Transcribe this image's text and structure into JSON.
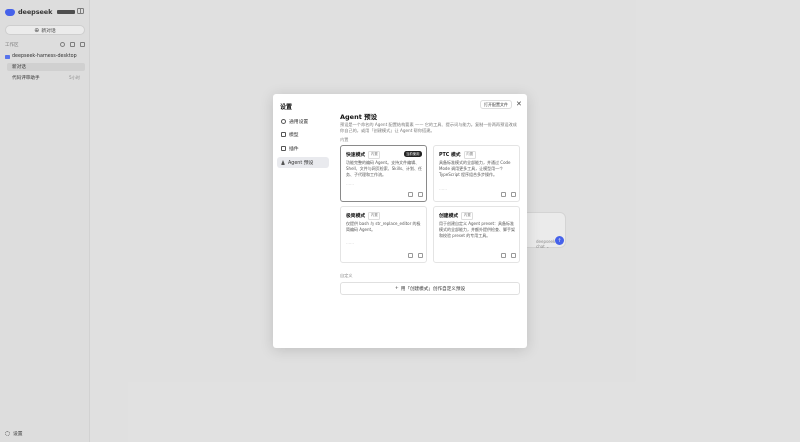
{
  "sidebar": {
    "brand": "deepseek",
    "new_chat": "新对话",
    "workspace_label": "工作区",
    "project": "deepseek-harness-desktop",
    "sessions": [
      {
        "title": "新对话",
        "time": ""
      },
      {
        "title": "代码评审助手",
        "time": "5小时"
      }
    ],
    "settings": "设置"
  },
  "main": {
    "model_label": "deepseek-chat ⌄"
  },
  "modal": {
    "title": "设置",
    "nav": [
      {
        "label": "通用设置",
        "icon": "settings-icon"
      },
      {
        "label": "模型",
        "icon": "model-icon"
      },
      {
        "label": "插件",
        "icon": "plugin-icon"
      },
      {
        "label": "Agent 预设",
        "icon": "agent-icon"
      }
    ],
    "open_config": "打开配置文件",
    "close": "✕",
    "section_title": "Agent 预设",
    "description": "预设是一个命名的 Agent 配置结构要素 —— 它的工具、提示词与能力。复制一份两再预设改成你自己的，或用「创建模式」让 Agent 帮你搭建。",
    "builtin_label": "内置",
    "cards": [
      {
        "name": "快速模式",
        "tag": "内置",
        "badge": "当前使用",
        "desc": "功能完整的编码 Agent。支持文件编辑、Shell、文件与网页检索、Skills、计划、任务、子代理和工作流。",
        "more": "……"
      },
      {
        "name": "PTC 模式",
        "tag": "内置",
        "badge": "",
        "desc": "具备标准模式的全部能力，并通过 Code Mode 调用更多工具，让模型用一个 TypeScript 程序组合多步操作。",
        "more": "……"
      },
      {
        "name": "极简模式",
        "tag": "内置",
        "badge": "",
        "desc": "仅提供 bash 与 str_replace_editor 的极简编码 Agent。",
        "more": "……"
      },
      {
        "name": "创建模式",
        "tag": "内置",
        "badge": "",
        "desc": "用于创建自定义 Agent preset：具备标准模式的全部能力，并额外提供检查、脚手架和校验 preset 的专用工具。",
        "more": ""
      }
    ],
    "custom_label": "自定义",
    "custom_button": "用「创建模式」创作自定义预设"
  }
}
